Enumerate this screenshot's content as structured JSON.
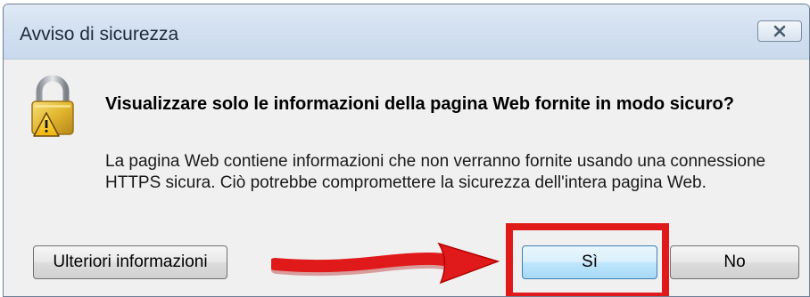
{
  "dialog": {
    "title": "Avviso di sicurezza",
    "close_icon": "close-icon",
    "warning_icon": "lock-warning-icon",
    "heading": "Visualizzare solo le informazioni della pagina Web fornite in modo sicuro?",
    "body": "La pagina Web contiene informazioni che non verranno fornite usando una connessione HTTPS sicura. Ciò potrebbe compromettere la sicurezza dell'intera pagina Web.",
    "buttons": {
      "more_info": "Ulteriori informazioni",
      "yes": "Sì",
      "no": "No"
    }
  },
  "annotation": {
    "arrow_icon": "red-arrow-icon",
    "highlight_color": "#e01a1a"
  }
}
